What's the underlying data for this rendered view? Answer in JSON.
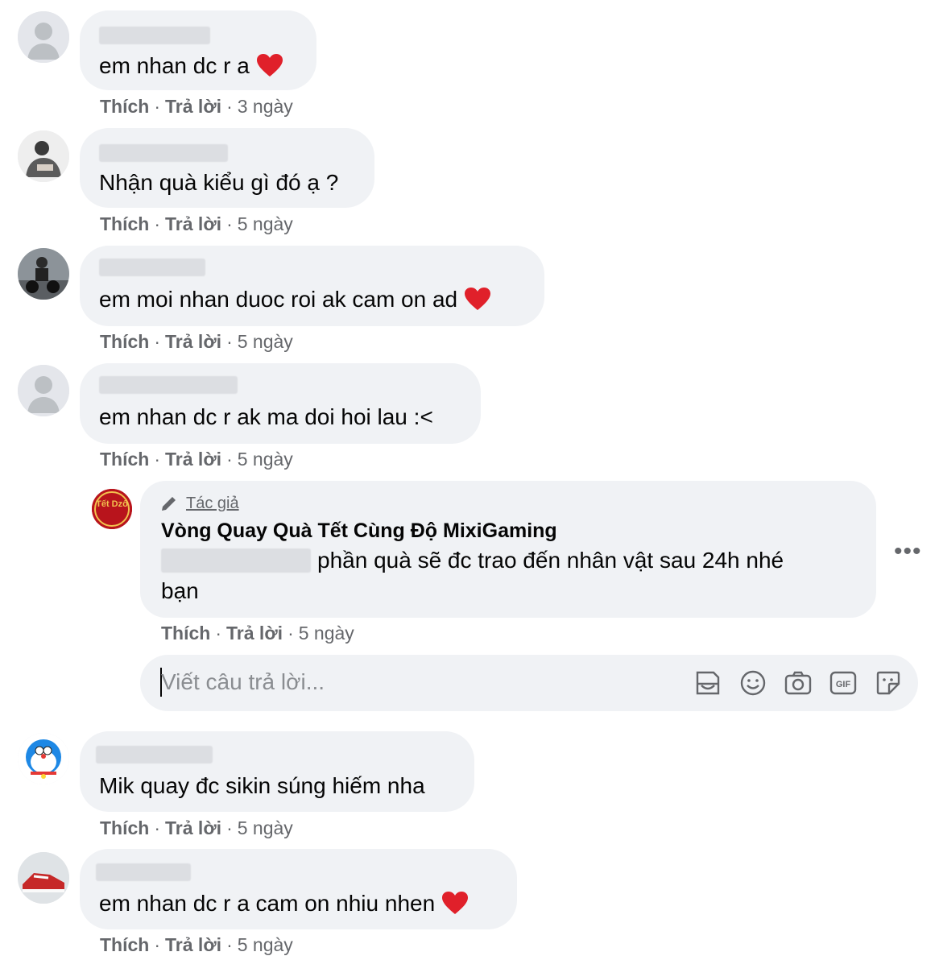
{
  "comments": [
    {
      "text": "em nhan dc r a",
      "heart": true,
      "like": "Thích",
      "reply": "Trả lời",
      "time": "3 ngày"
    },
    {
      "text": "Nhận quà kiểu gì đó ạ ?",
      "heart": false,
      "like": "Thích",
      "reply": "Trả lời",
      "time": "5 ngày"
    },
    {
      "text": "em moi nhan duoc roi ak cam on ad",
      "heart": true,
      "like": "Thích",
      "reply": "Trả lời",
      "time": "5 ngày"
    },
    {
      "text": "em nhan dc r ak ma doi hoi lau :<",
      "heart": false,
      "like": "Thích",
      "reply": "Trả lời",
      "time": "5 ngày"
    },
    {
      "text": "Mik quay đc sikin súng hiếm nha",
      "heart": false,
      "like": "Thích",
      "reply": "Trả lời",
      "time": "5 ngày"
    },
    {
      "text": "em nhan dc r a cam on nhiu nhen",
      "heart": true,
      "like": "Thích",
      "reply": "Trả lời",
      "time": "5 ngày"
    }
  ],
  "author_reply": {
    "tag": "Tác giả",
    "name": "Vòng Quay Quà Tết Cùng Độ MixiGaming",
    "text_line1": "phần quà sẽ đc trao đến nhân vật sau 24h nhé",
    "text_line2": "bạn",
    "like": "Thích",
    "reply": "Trả lời",
    "time": "5 ngày",
    "avatar_text": "Tết Dzô",
    "more": "•••"
  },
  "reply_box": {
    "placeholder": "Viết câu trả lời...",
    "icons": [
      "avatar-sticker-icon",
      "emoji-icon",
      "camera-icon",
      "gif-icon",
      "sticker-icon"
    ]
  },
  "colors": {
    "bubble": "#f0f2f5",
    "meta": "#65676b",
    "heart": "#e0202a",
    "author_avatar": "#b8141c"
  }
}
